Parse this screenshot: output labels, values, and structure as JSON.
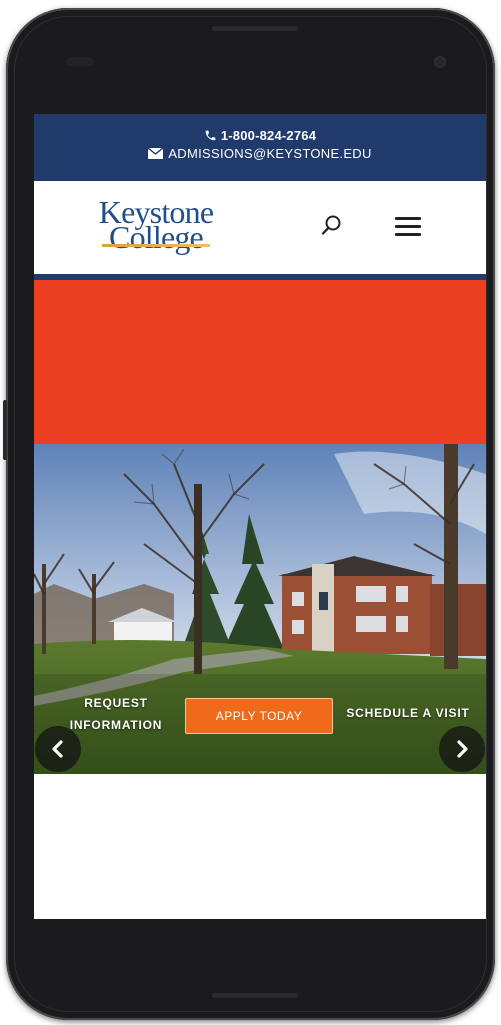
{
  "contact": {
    "phone": "1-800-824-2764",
    "email": "ADMISSIONS@KEYSTONE.EDU"
  },
  "logo": {
    "line1": "Keystone",
    "line2": "College"
  },
  "icons": {
    "phone": "phone-icon",
    "email": "envelope-icon",
    "search": "search-icon",
    "menu": "hamburger-menu-icon",
    "prev": "chevron-left-icon",
    "next": "chevron-right-icon"
  },
  "hero": {
    "request_label": "REQUEST INFORMATION",
    "apply_label": "APPLY TODAY",
    "visit_label": "SCHEDULE A VISIT"
  },
  "colors": {
    "navy": "#1f3a6b",
    "red_band": "#ec4022",
    "apply_orange": "#ef6b1a"
  }
}
